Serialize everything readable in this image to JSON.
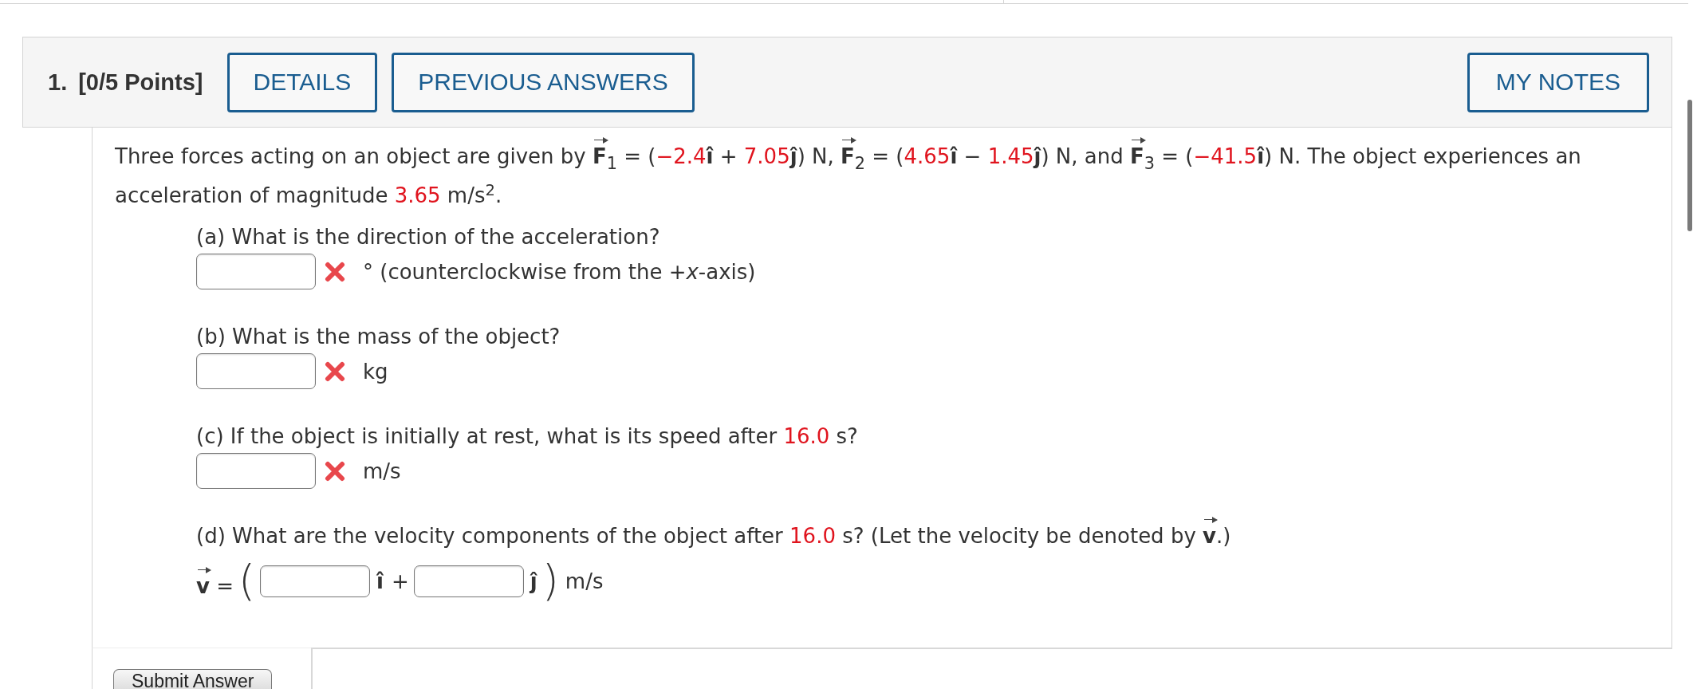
{
  "header": {
    "number": "1.",
    "points": "[0/5 Points]",
    "buttons": [
      {
        "label": "DETAILS"
      },
      {
        "label": "PREVIOUS ANSWERS"
      }
    ],
    "notes_button": "MY NOTES"
  },
  "problem": {
    "segments": [
      {
        "kind": "text",
        "text": "Three forces acting on an object are given by "
      },
      {
        "kind": "vector",
        "symbol": "F",
        "subscript": "1"
      },
      {
        "kind": "text",
        "text": " = ("
      },
      {
        "kind": "given",
        "text": "−2.4"
      },
      {
        "kind": "text",
        "text": "**î** + "
      },
      {
        "kind": "given",
        "text": "7.05"
      },
      {
        "kind": "text",
        "text": "**ĵ**) N, "
      },
      {
        "kind": "vector",
        "symbol": "F",
        "subscript": "2"
      },
      {
        "kind": "text",
        "text": " = ("
      },
      {
        "kind": "given",
        "text": "4.65"
      },
      {
        "kind": "text",
        "text": "**î** − "
      },
      {
        "kind": "given",
        "text": "1.45"
      },
      {
        "kind": "text",
        "text": "**ĵ**) N, and "
      },
      {
        "kind": "vector",
        "symbol": "F",
        "subscript": "3"
      },
      {
        "kind": "text",
        "text": " = ("
      },
      {
        "kind": "given",
        "text": "−41.5"
      },
      {
        "kind": "text",
        "text": "**î**) N. The object experiences an acceleration of magnitude "
      },
      {
        "kind": "given",
        "text": "3.65"
      },
      {
        "kind": "text",
        "text": " m/s$^{2}$."
      }
    ]
  },
  "parts": [
    {
      "question": [
        {
          "kind": "text",
          "text": "(a) What is the direction of the acceleration?"
        }
      ],
      "answer": {
        "kind": "single",
        "correct": false,
        "unit": "° (counterclockwise from the +*x*-axis)"
      }
    },
    {
      "question": [
        {
          "kind": "text",
          "text": "(b) What is the mass of the object?"
        }
      ],
      "answer": {
        "kind": "single",
        "correct": false,
        "unit": "kg"
      }
    },
    {
      "question": [
        {
          "kind": "text",
          "text": "(c) If the object is initially at rest, what is its speed after "
        },
        {
          "kind": "given",
          "text": "16.0"
        },
        {
          "kind": "text",
          "text": " s?"
        }
      ],
      "answer": {
        "kind": "single",
        "correct": false,
        "unit": "m/s"
      }
    },
    {
      "question": [
        {
          "kind": "text",
          "text": "(d) What are the velocity components of the object after "
        },
        {
          "kind": "given",
          "text": "16.0"
        },
        {
          "kind": "text",
          "text": " s? (Let the velocity be denoted by "
        },
        {
          "kind": "vector",
          "symbol": "v"
        },
        {
          "kind": "text",
          "text": ".)"
        }
      ],
      "answer": {
        "kind": "vector",
        "symbol": "v",
        "equals": "=",
        "open": "(",
        "components": [
          {
            "unit": "î",
            "joiner": "+"
          },
          {
            "unit": "ĵ"
          }
        ],
        "close": ")",
        "unit": "m/s"
      }
    }
  ],
  "submit": {
    "label": "Submit Answer"
  }
}
